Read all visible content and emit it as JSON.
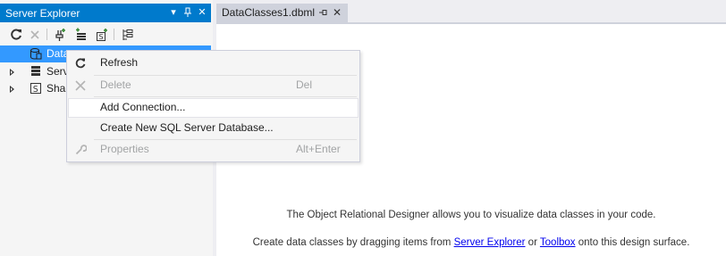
{
  "server_explorer": {
    "title": "Server Explorer",
    "title_buttons": {
      "dropdown": "▾",
      "pin": "⊣",
      "close": "✕"
    },
    "toolbar": [
      "refresh-icon",
      "stop-icon",
      "connect-to-database-icon",
      "connect-to-server-icon",
      "connect-to-sharepoint-icon",
      "properties-icon"
    ],
    "tree": [
      {
        "label": "Data",
        "icon": "data-connections-icon",
        "selected": true
      },
      {
        "label": "Serv",
        "icon": "servers-icon",
        "selected": false
      },
      {
        "label": "Shar",
        "icon": "sharepoint-icon",
        "selected": false
      }
    ]
  },
  "document_tab": {
    "label": "DataClasses1.dbml",
    "pin": "⊣",
    "close": "✕"
  },
  "designer": {
    "hint_line1": "The Object Relational Designer allows you to visualize data classes in your code.",
    "hint_line2_prefix": "Create data classes by dragging items from ",
    "hint_link1": "Server Explorer",
    "hint_line2_middle": " or ",
    "hint_link2": "Toolbox",
    "hint_line2_suffix": " onto this design surface."
  },
  "context_menu": {
    "items": [
      {
        "label": "Refresh",
        "shortcut": "",
        "icon": "refresh-icon",
        "enabled": true
      },
      {
        "label": "Delete",
        "shortcut": "Del",
        "icon": "delete-icon",
        "enabled": false
      },
      {
        "label": "Add Connection...",
        "shortcut": "",
        "icon": "",
        "enabled": true,
        "hover": true
      },
      {
        "label": "Create New SQL Server Database...",
        "shortcut": "",
        "icon": "",
        "enabled": true
      },
      {
        "label": "Properties",
        "shortcut": "Alt+Enter",
        "icon": "wrench-icon",
        "enabled": false
      }
    ]
  },
  "colors": {
    "accent": "#007acc",
    "selection": "#3399ff",
    "menu_background": "#f5f5f5",
    "disabled_text": "#a2a4a5",
    "link": "#0000ee"
  }
}
